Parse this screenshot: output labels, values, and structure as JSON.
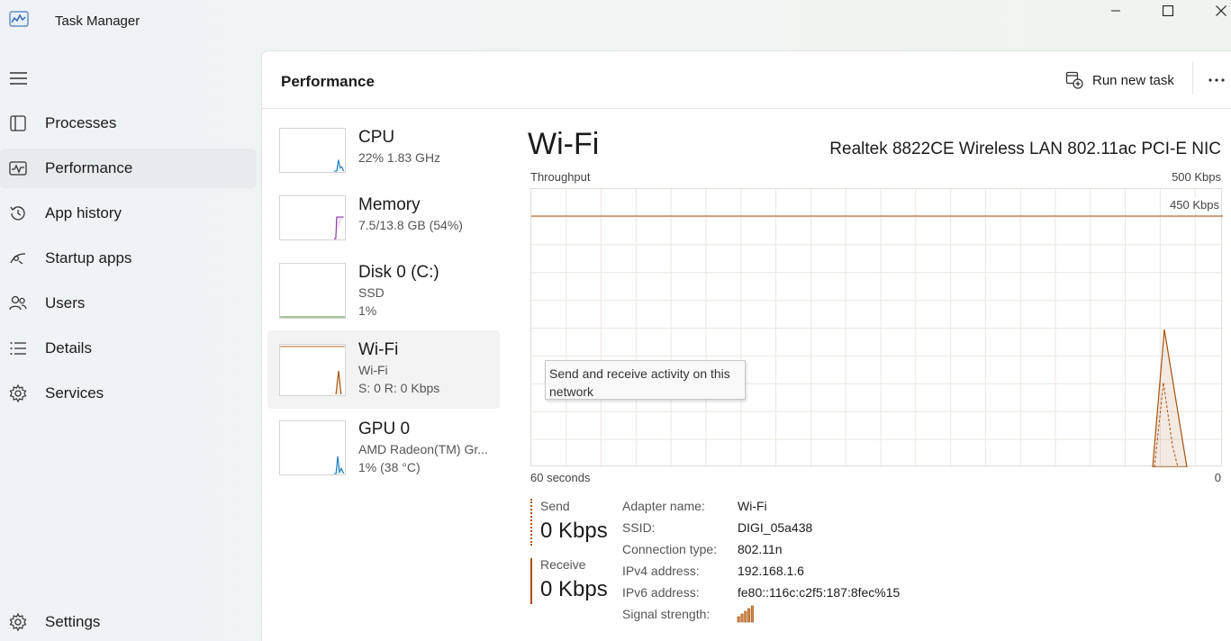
{
  "app": {
    "title": "Task Manager"
  },
  "sidebar": {
    "items": [
      {
        "label": "Processes",
        "icon": "processes-icon"
      },
      {
        "label": "Performance",
        "icon": "performance-icon",
        "active": true
      },
      {
        "label": "App history",
        "icon": "app-history-icon"
      },
      {
        "label": "Startup apps",
        "icon": "startup-apps-icon"
      },
      {
        "label": "Users",
        "icon": "users-icon"
      },
      {
        "label": "Details",
        "icon": "details-icon"
      },
      {
        "label": "Services",
        "icon": "services-icon"
      }
    ],
    "settings_label": "Settings"
  },
  "header": {
    "page_title": "Performance",
    "run_task_label": "Run new task"
  },
  "devices": [
    {
      "name": "CPU",
      "sub1": "22%  1.83 GHz",
      "sub2": "",
      "color": "#1a7fbf"
    },
    {
      "name": "Memory",
      "sub1": "7.5/13.8 GB (54%)",
      "sub2": "",
      "color": "#8b3aa8"
    },
    {
      "name": "Disk 0 (C:)",
      "sub1": "SSD",
      "sub2": "1%",
      "color": "#4d8a2f"
    },
    {
      "name": "Wi-Fi",
      "sub1": "Wi-Fi",
      "sub2": "S: 0  R: 0 Kbps",
      "color": "#a7520f",
      "active": true
    },
    {
      "name": "GPU 0",
      "sub1": "AMD Radeon(TM) Gr...",
      "sub2": "1%  (38 °C)",
      "color": "#1a7fbf"
    }
  ],
  "detail": {
    "title": "Wi-Fi",
    "adapter": "Realtek 8822CE Wireless LAN 802.11ac PCI-E NIC",
    "throughput_label": "Throughput",
    "max_label": "500 Kbps",
    "line_label": "450 Kbps",
    "x_left_label": "60 seconds",
    "x_right_label": "0",
    "tooltip": "Send and receive activity on this network",
    "accent_color": "#a7520f"
  },
  "stats": {
    "send_label": "Send",
    "send_value": "0 Kbps",
    "receive_label": "Receive",
    "receive_value": "0 Kbps"
  },
  "properties": [
    {
      "key": "Adapter name:",
      "value": "Wi-Fi"
    },
    {
      "key": "SSID:",
      "value": "DIGI_05a438"
    },
    {
      "key": "Connection type:",
      "value": "802.11n"
    },
    {
      "key": "IPv4 address:",
      "value": "192.168.1.6"
    },
    {
      "key": "IPv6 address:",
      "value": "fe80::116c:c2f5:187:8fec%15"
    },
    {
      "key": "Signal strength:",
      "value": ""
    }
  ],
  "signal_strength_bars": 5
}
